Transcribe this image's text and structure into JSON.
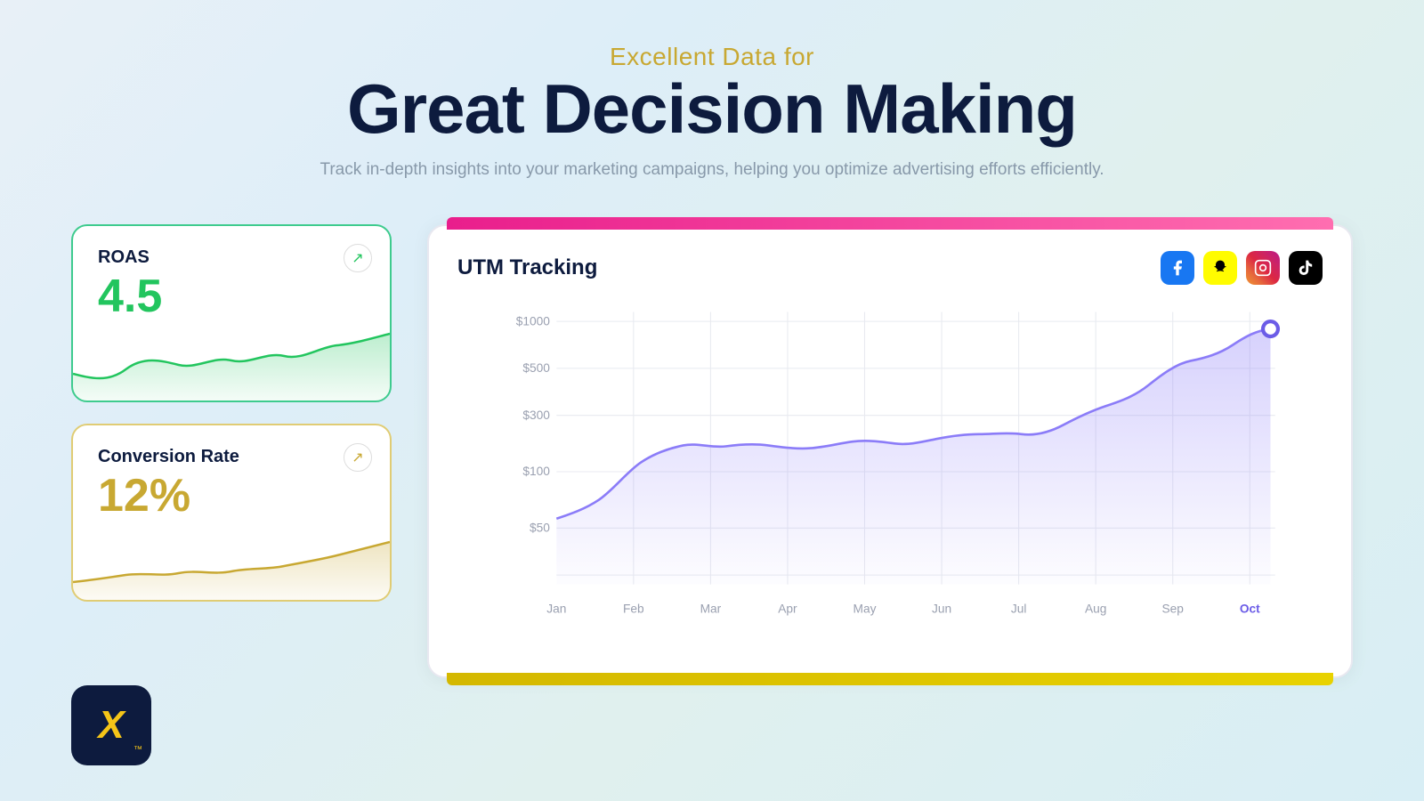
{
  "header": {
    "subtitle": "Excellent Data for",
    "title": "Great Decision Making",
    "description": "Track in-depth insights into your marketing campaigns, helping you optimize advertising efforts efficiently."
  },
  "roas_card": {
    "label": "ROAS",
    "value": "4.5",
    "arrow": "↗"
  },
  "conversion_card": {
    "label": "Conversion Rate",
    "value": "12%",
    "arrow": "↗"
  },
  "utm_card": {
    "title": "UTM Tracking",
    "social_icons": [
      {
        "name": "facebook",
        "class": "fb",
        "symbol": "f"
      },
      {
        "name": "snapchat",
        "class": "snap",
        "symbol": "👻"
      },
      {
        "name": "instagram",
        "class": "ig",
        "symbol": "📷"
      },
      {
        "name": "tiktok",
        "class": "tiktok",
        "symbol": "♪"
      }
    ],
    "y_labels": [
      "$1000",
      "$500",
      "$300",
      "$100",
      "$50"
    ],
    "x_labels": [
      "Jan",
      "Feb",
      "Mar",
      "Apr",
      "May",
      "Jun",
      "Jul",
      "Aug",
      "Sep",
      "Oct"
    ],
    "active_x_label": "Oct"
  },
  "logo": {
    "symbol": "X",
    "tm": "™"
  }
}
